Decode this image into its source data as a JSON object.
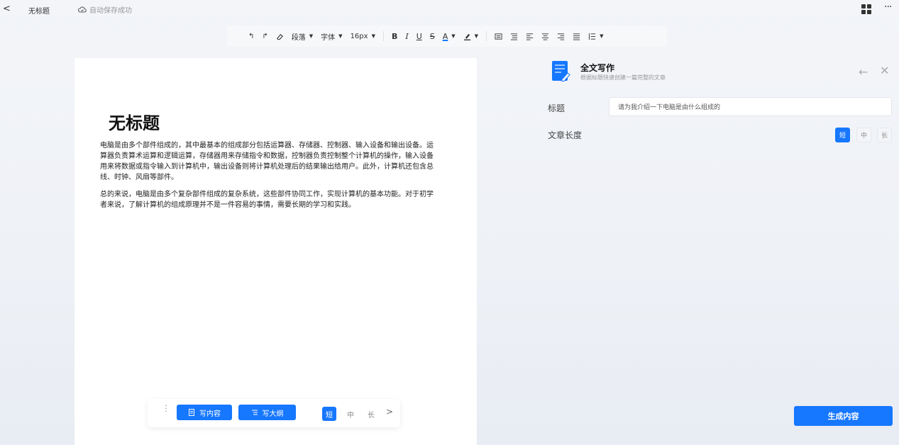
{
  "topbar": {
    "back_glyph": "<",
    "doc_name": "无标题",
    "save_status": "自动保存成功",
    "more_glyph": "···"
  },
  "toolbar": {
    "undo_glyph": "↰",
    "redo_glyph": "↱",
    "clear_glyph": "⌫",
    "paragraph": "段落",
    "font": "字体",
    "font_size": "16px",
    "bold": "B",
    "italic": "I",
    "underline": "U",
    "strike": "S",
    "text_color": "A",
    "caret": "▼"
  },
  "document": {
    "title": "无标题",
    "paragraphs": [
      "电脑是由多个部件组成的，其中最基本的组成部分包括运算器、存储器、控制器、输入设备和输出设备。运算器负责算术运算和逻辑运算，存储器用来存储指令和数据，控制器负责控制整个计算机的操作，输入设备用来将数据或指令输入到计算机中，输出设备则将计算机处理后的结果输出给用户。此外，计算机还包含总线、时钟、风扇等部件。",
      "总的来说，电脑是由多个复杂部件组成的复杂系统，这些部件协同工作，实现计算机的基本功能。对于初学者来说，了解计算机的组成原理并不是一件容易的事情，需要长期的学习和实践。"
    ]
  },
  "float_toolbar": {
    "drag_glyph": "⋮",
    "write_content": "写内容",
    "write_outline": "写大纲",
    "short": "短",
    "medium": "中",
    "long": "长",
    "next_glyph": ">"
  },
  "panel": {
    "title": "全文写作",
    "subtitle": "根据标题快速创建一篇完整的文章",
    "back_glyph": "←",
    "close_glyph": "✕",
    "title_label": "标题",
    "title_value": "请为我介绍一下电脑是由什么组成的",
    "length_label": "文章长度",
    "short": "短",
    "medium": "中",
    "long": "长",
    "generate": "生成内容"
  },
  "colors": {
    "accent": "#1677ff",
    "text_color_underline": "#1677ff"
  }
}
